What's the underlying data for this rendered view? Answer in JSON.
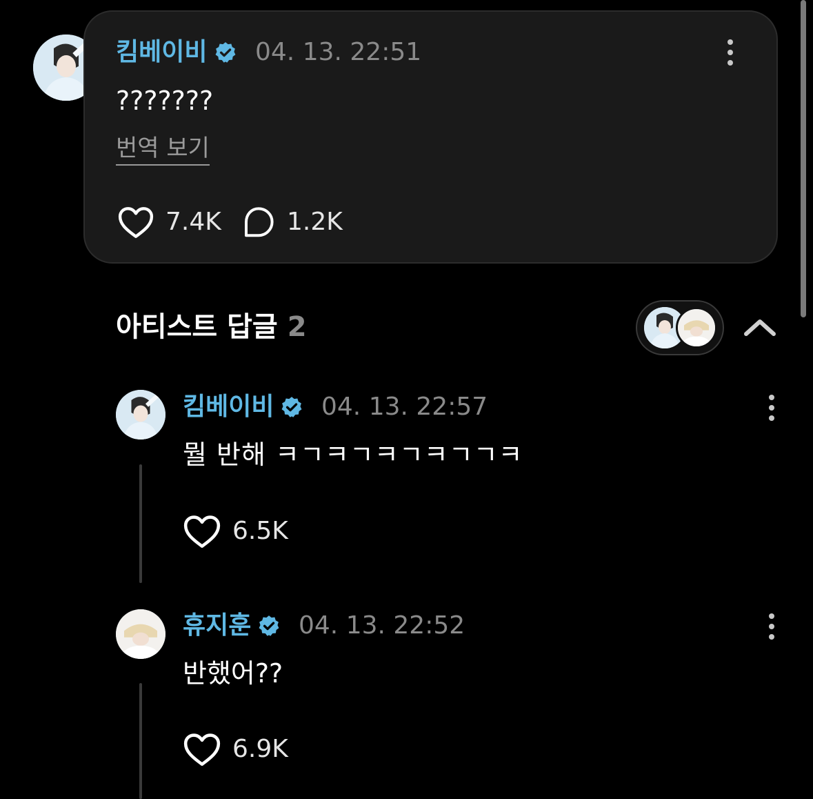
{
  "main_comment": {
    "author": "킴베이비",
    "timestamp": "04. 13. 22:51",
    "text": "???????",
    "translate_label": "번역 보기",
    "likes": "7.4K",
    "replies": "1.2K"
  },
  "artist_replies": {
    "title": "아티스트 답글",
    "count": "2",
    "items": [
      {
        "author": "킴베이비",
        "timestamp": "04. 13. 22:57",
        "text": "뭘 반해 ㅋㄱㅋㄱㅋㄱㅋㄱㄱㅋ",
        "likes": "6.5K"
      },
      {
        "author": "휴지훈",
        "timestamp": "04. 13. 22:52",
        "text": "반했어??",
        "likes": "6.9K"
      }
    ]
  },
  "icons": {
    "verified": "verified-badge-icon",
    "more": "more-vertical-icon",
    "like": "heart-icon",
    "comment": "comment-bubble-icon",
    "collapse": "chevron-up-icon"
  },
  "colors": {
    "background": "#000000",
    "card": "#1a1a1a",
    "accent_name": "#5fb8e4",
    "muted": "#8a8a8a"
  }
}
